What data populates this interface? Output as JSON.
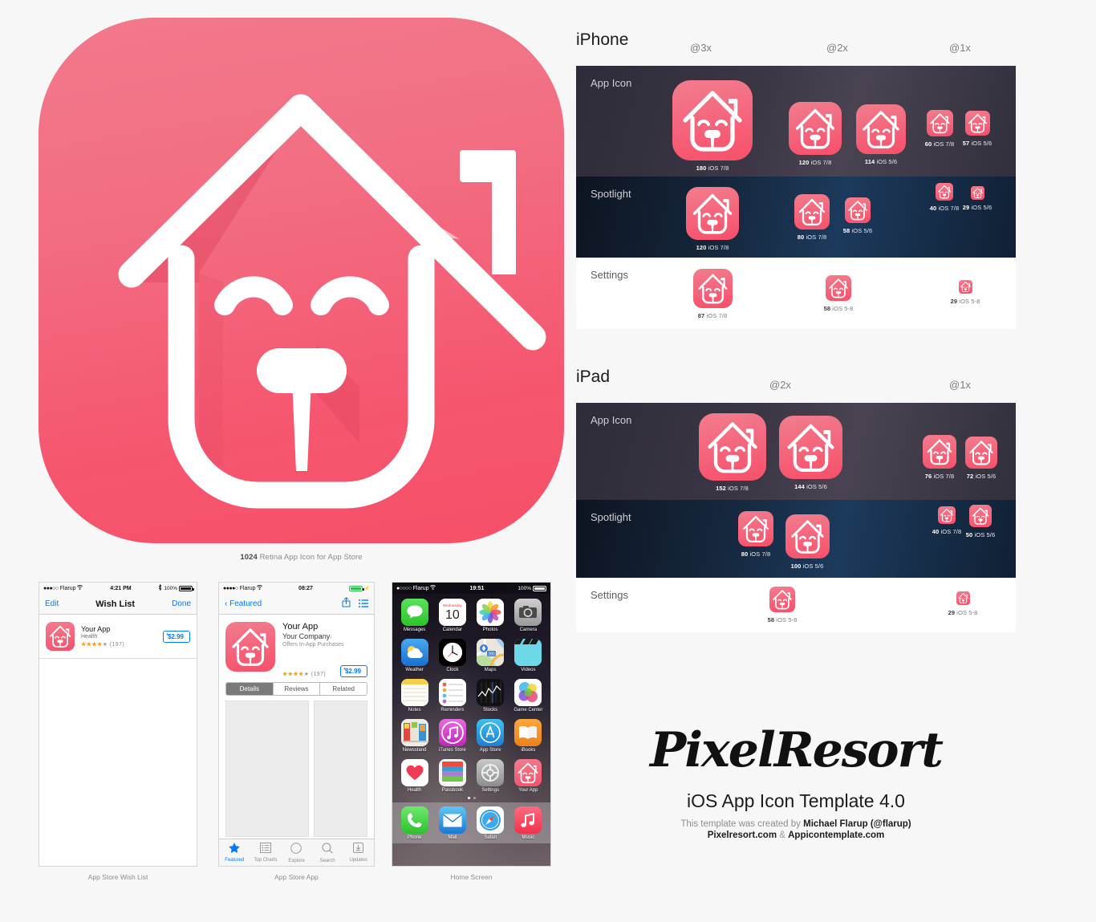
{
  "hero": {
    "caption_bold": "1024",
    "caption_rest": " Retina App Icon for App Store"
  },
  "devices": [
    {
      "name": "iPhone",
      "scales": [
        "@3x",
        "@2x",
        "@1x"
      ],
      "rows": [
        {
          "label": "App Icon",
          "slots": [
            {
              "size": 100,
              "num": "180",
              "os": "iOS 7/8"
            },
            {
              "size": 66,
              "num": "120",
              "os": "iOS 7/8"
            },
            {
              "size": 62,
              "num": "114",
              "os": "iOS 5/6"
            },
            {
              "size": 33,
              "num": "60",
              "os": "iOS 7/8"
            },
            {
              "size": 31,
              "num": "57",
              "os": "iOS 5/6"
            }
          ]
        },
        {
          "label": "Spotlight",
          "slots": [
            {
              "size": 66,
              "num": "120",
              "os": "iOS 7/8"
            },
            {
              "size": 44,
              "num": "80",
              "os": "iOS 7/8"
            },
            {
              "size": 32,
              "num": "58",
              "os": "iOS 5/6"
            },
            {
              "size": 22,
              "num": "40",
              "os": "iOS 7/8"
            },
            {
              "size": 17,
              "num": "29",
              "os": "iOS 5/6"
            }
          ]
        },
        {
          "label": "Settings",
          "slots": [
            {
              "size": 49,
              "num": "87",
              "os": "iOS 7/8"
            },
            {
              "size": 32,
              "num": "58",
              "os": "iOS 5-8"
            },
            {
              "size": 17,
              "num": "29",
              "os": "iOS 5-8"
            }
          ]
        }
      ]
    },
    {
      "name": "iPad",
      "scales": [
        "@2x",
        "@1x"
      ],
      "rows": [
        {
          "label": "App Icon",
          "slots": [
            {
              "size": 84,
              "num": "152",
              "os": "iOS 7/8"
            },
            {
              "size": 79,
              "num": "144",
              "os": "iOS 5/6"
            },
            {
              "size": 42,
              "num": "76",
              "os": "iOS 7/8"
            },
            {
              "size": 40,
              "num": "72",
              "os": "iOS 5/6"
            }
          ]
        },
        {
          "label": "Spotlight",
          "slots": [
            {
              "size": 44,
              "num": "80",
              "os": "iOS 7/8"
            },
            {
              "size": 55,
              "num": "100",
              "os": "iOS 5/6"
            },
            {
              "size": 22,
              "num": "40",
              "os": "iOS 7/8"
            },
            {
              "size": 28,
              "num": "50",
              "os": "iOS 5/6"
            }
          ]
        },
        {
          "label": "Settings",
          "slots": [
            {
              "size": 32,
              "num": "58",
              "os": "iOS 5-8"
            },
            {
              "size": 17,
              "num": "29",
              "os": "iOS 5-8"
            }
          ]
        }
      ]
    }
  ],
  "branding": {
    "logo": "PixelResort",
    "title": "iOS App Icon Template 4.0",
    "credit_prefix": "This template was created by ",
    "credit_author": "Michael Flarup (@flarup)",
    "link_a": "Pixelresort.com",
    "link_amp": " & ",
    "link_b": "Appicontemplate.com"
  },
  "mockups": {
    "wishlist": {
      "caption": "App Store Wish List",
      "status": {
        "carrier": "Flarup",
        "dots": "●●●○○",
        "wifi": "▾",
        "time": "4:21 PM",
        "battery_pct": "100%",
        "bt": "ᛒ"
      },
      "nav": {
        "left": "Edit",
        "title": "Wish List",
        "right": "Done"
      },
      "row": {
        "app_name": "Your App",
        "category": "Health",
        "stars": "★★★★",
        "star_empty": "★",
        "rating_count": "(197)",
        "price": "$2.99",
        "price_sup": "+"
      }
    },
    "appstore": {
      "caption": "App Store App",
      "status": {
        "carrier": "Flarup",
        "dots": "●●●●○",
        "time": "08:27"
      },
      "nav": {
        "back": "Featured"
      },
      "app_name": "Your App",
      "company": "Your Company",
      "company_chevron": "›",
      "iap": "Offers In-App Purchases",
      "stars": "★★★★",
      "star_empty": "★",
      "rating_count": "(197)",
      "price": "$2.99",
      "price_sup": "+",
      "segments": [
        "Details",
        "Reviews",
        "Related"
      ],
      "active_segment": "Details",
      "tabs": [
        {
          "label": "Featured",
          "icon": "star-icon"
        },
        {
          "label": "Top Charts",
          "icon": "list-icon"
        },
        {
          "label": "Explore",
          "icon": "compass-icon"
        },
        {
          "label": "Search",
          "icon": "search-icon"
        },
        {
          "label": "Updates",
          "icon": "download-icon"
        }
      ],
      "active_tab": "Featured"
    },
    "homescreen": {
      "caption": "Home Screen",
      "status": {
        "carrier": "Flarup",
        "dots": "●○○○○",
        "time": "19:51",
        "battery_pct": "100%"
      },
      "calendar": {
        "weekday": "Wednesday",
        "day": "10"
      },
      "apps": [
        {
          "label": "Messages",
          "icon": "messages-icon"
        },
        {
          "label": "Calendar",
          "icon": "calendar-icon"
        },
        {
          "label": "Photos",
          "icon": "photos-icon"
        },
        {
          "label": "Camera",
          "icon": "camera-icon"
        },
        {
          "label": "Weather",
          "icon": "weather-icon"
        },
        {
          "label": "Clock",
          "icon": "clock-icon"
        },
        {
          "label": "Maps",
          "icon": "maps-icon"
        },
        {
          "label": "Videos",
          "icon": "videos-icon"
        },
        {
          "label": "Notes",
          "icon": "notes-icon"
        },
        {
          "label": "Reminders",
          "icon": "reminders-icon"
        },
        {
          "label": "Stocks",
          "icon": "stocks-icon"
        },
        {
          "label": "Game Center",
          "icon": "gamecenter-icon"
        },
        {
          "label": "Newsstand",
          "icon": "newsstand-icon"
        },
        {
          "label": "iTunes Store",
          "icon": "itunes-icon"
        },
        {
          "label": "App Store",
          "icon": "appstore-icon"
        },
        {
          "label": "iBooks",
          "icon": "ibooks-icon"
        },
        {
          "label": "Health",
          "icon": "health-icon"
        },
        {
          "label": "Passbook",
          "icon": "passbook-icon"
        },
        {
          "label": "Settings",
          "icon": "settings-icon"
        },
        {
          "label": "Your App",
          "icon": "yourapp-icon"
        }
      ],
      "dock": [
        {
          "label": "Phone",
          "icon": "phone-icon"
        },
        {
          "label": "Mail",
          "icon": "mail-icon"
        },
        {
          "label": "Safari",
          "icon": "safari-icon"
        },
        {
          "label": "Music",
          "icon": "music-icon"
        }
      ],
      "maps_badge": "280"
    }
  },
  "colors": {
    "brand_pink": "#f5576f",
    "brand_pink_light": "#f2798b",
    "ios_blue": "#007aff",
    "page_bg": "#f7f7f7"
  }
}
